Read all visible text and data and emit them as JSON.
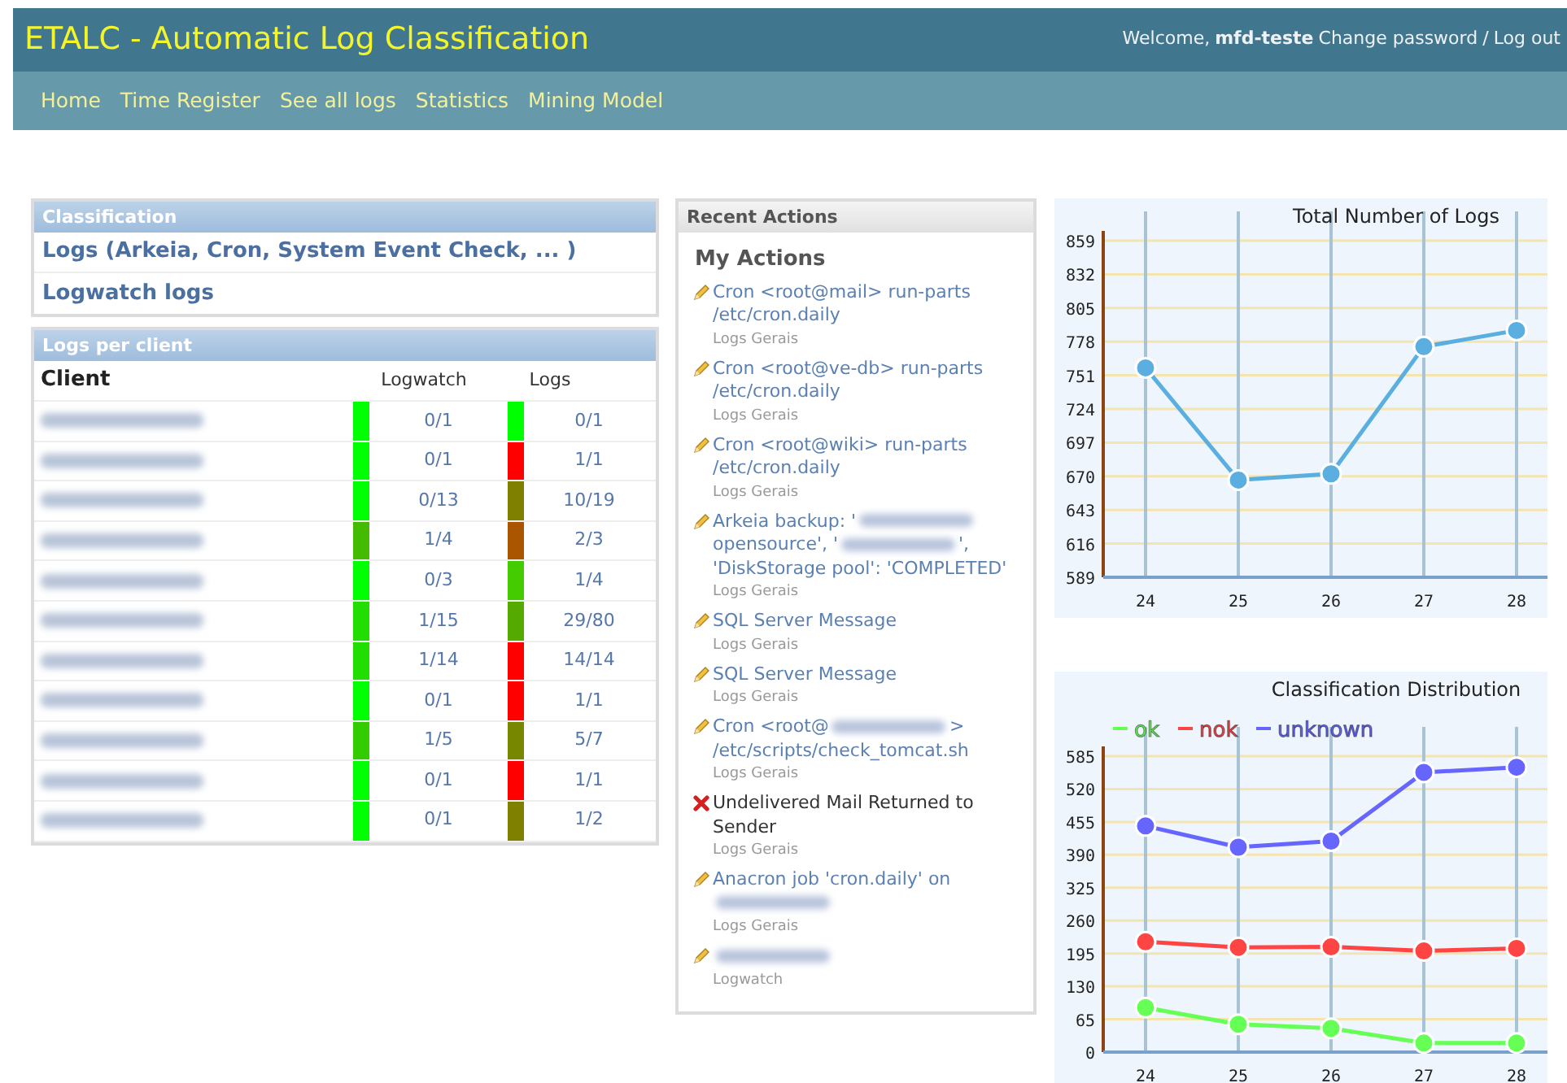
{
  "header": {
    "title": "ETALC - Automatic Log Classification",
    "welcome": "Welcome,",
    "user": "mfd-teste",
    "change_password": "Change password",
    "separator": "/",
    "logout": "Log out"
  },
  "nav": [
    "Home",
    "Time Register",
    "See all logs",
    "Statistics",
    "Mining Model"
  ],
  "classification": {
    "heading": "Classification",
    "links": [
      "Logs (Arkeia, Cron, System Event Check, ... )",
      "Logwatch logs"
    ]
  },
  "logs_per_client": {
    "heading": "Logs per client",
    "columns": [
      "Client",
      "Logwatch",
      "Logs"
    ],
    "rows": [
      {
        "logwatch": {
          "value": "0/1",
          "color": "#00ff00"
        },
        "logs": {
          "value": "0/1",
          "color": "#00ff00"
        }
      },
      {
        "logwatch": {
          "value": "0/1",
          "color": "#00ff00"
        },
        "logs": {
          "value": "1/1",
          "color": "#ff0000"
        }
      },
      {
        "logwatch": {
          "value": "0/13",
          "color": "#00ff00"
        },
        "logs": {
          "value": "10/19",
          "color": "#808000"
        }
      },
      {
        "logwatch": {
          "value": "1/4",
          "color": "#44bb00"
        },
        "logs": {
          "value": "2/3",
          "color": "#aa5500"
        }
      },
      {
        "logwatch": {
          "value": "0/3",
          "color": "#00ff00"
        },
        "logs": {
          "value": "1/4",
          "color": "#44cc00"
        }
      },
      {
        "logwatch": {
          "value": "1/15",
          "color": "#22dd00"
        },
        "logs": {
          "value": "29/80",
          "color": "#55aa00"
        }
      },
      {
        "logwatch": {
          "value": "1/14",
          "color": "#22dd00"
        },
        "logs": {
          "value": "14/14",
          "color": "#ff0000"
        }
      },
      {
        "logwatch": {
          "value": "0/1",
          "color": "#00ff00"
        },
        "logs": {
          "value": "1/1",
          "color": "#ff0000"
        }
      },
      {
        "logwatch": {
          "value": "1/5",
          "color": "#33cc00"
        },
        "logs": {
          "value": "5/7",
          "color": "#778800"
        }
      },
      {
        "logwatch": {
          "value": "0/1",
          "color": "#00ff00"
        },
        "logs": {
          "value": "1/1",
          "color": "#ff0000"
        }
      },
      {
        "logwatch": {
          "value": "0/1",
          "color": "#00ff00"
        },
        "logs": {
          "value": "1/2",
          "color": "#808000"
        }
      }
    ]
  },
  "recent_actions": {
    "heading": "Recent Actions",
    "subheading": "My Actions",
    "items": [
      {
        "kind": "edit",
        "title": [
          {
            "kind": "text",
            "text": "Cron <root@mail> run-parts /etc/cron.daily"
          }
        ],
        "category": "Logs Gerais"
      },
      {
        "kind": "edit",
        "title": [
          {
            "kind": "text",
            "text": "Cron <root@ve-db> run-parts /etc/cron.daily"
          }
        ],
        "category": "Logs Gerais"
      },
      {
        "kind": "edit",
        "title": [
          {
            "kind": "text",
            "text": "Cron <root@wiki> run-parts /etc/cron.daily"
          }
        ],
        "category": "Logs Gerais"
      },
      {
        "kind": "edit",
        "title": [
          {
            "kind": "text",
            "text": "Arkeia backup: '"
          },
          {
            "kind": "redacted"
          },
          {
            "kind": "text",
            "text": "opensource', '"
          },
          {
            "kind": "redacted"
          },
          {
            "kind": "text",
            "text": "', 'DiskStorage pool': 'COMPLETED'"
          }
        ],
        "category": "Logs Gerais"
      },
      {
        "kind": "edit",
        "title": [
          {
            "kind": "text",
            "text": "SQL Server Message"
          }
        ],
        "category": "Logs Gerais"
      },
      {
        "kind": "edit",
        "title": [
          {
            "kind": "text",
            "text": "SQL Server Message"
          }
        ],
        "category": "Logs Gerais"
      },
      {
        "kind": "edit",
        "title": [
          {
            "kind": "text",
            "text": "Cron <root@"
          },
          {
            "kind": "redacted"
          },
          {
            "kind": "text",
            "text": "> /etc/scripts/check_tomcat.sh"
          }
        ],
        "category": "Logs Gerais"
      },
      {
        "kind": "delete",
        "title": [
          {
            "kind": "text",
            "text": "Undelivered Mail Returned to Sender"
          }
        ],
        "category": "Logs Gerais"
      },
      {
        "kind": "edit",
        "title": [
          {
            "kind": "text",
            "text": "Anacron job 'cron.daily' on"
          },
          {
            "kind": "redacted"
          }
        ],
        "category": "Logs Gerais"
      },
      {
        "kind": "edit",
        "title": [
          {
            "kind": "redacted"
          }
        ],
        "category": "Logwatch"
      }
    ]
  },
  "total_chart": {
    "chart_data": {
      "type": "line",
      "title": "Total Number of Logs",
      "grid": true,
      "categories": [
        "24",
        "25",
        "26",
        "27",
        "28"
      ],
      "series": [
        {
          "color": "#5aafe0",
          "marker": "circle",
          "values": [
            757,
            667,
            672,
            774,
            787
          ]
        }
      ],
      "ylim": [
        589,
        859
      ],
      "yticks": [
        589,
        616,
        643,
        670,
        697,
        724,
        751,
        778,
        805,
        832,
        859
      ]
    }
  },
  "distribution_chart": {
    "chart_data": {
      "type": "line",
      "title": "Classification Distribution",
      "grid": true,
      "legend": "top",
      "categories": [
        "24",
        "25",
        "26",
        "27",
        "28"
      ],
      "series": [
        {
          "name": "ok",
          "color": "#66ff55",
          "marker": "circle",
          "values": [
            88,
            55,
            47,
            18,
            18
          ]
        },
        {
          "name": "nok",
          "color": "#ff4444",
          "marker": "circle",
          "values": [
            218,
            207,
            208,
            200,
            205
          ]
        },
        {
          "name": "unknown",
          "color": "#6666ff",
          "marker": "circle",
          "values": [
            447,
            405,
            417,
            553,
            563
          ]
        }
      ],
      "ylim": [
        0,
        585
      ],
      "yticks": [
        0,
        65,
        130,
        195,
        260,
        325,
        390,
        455,
        520,
        585
      ]
    }
  }
}
